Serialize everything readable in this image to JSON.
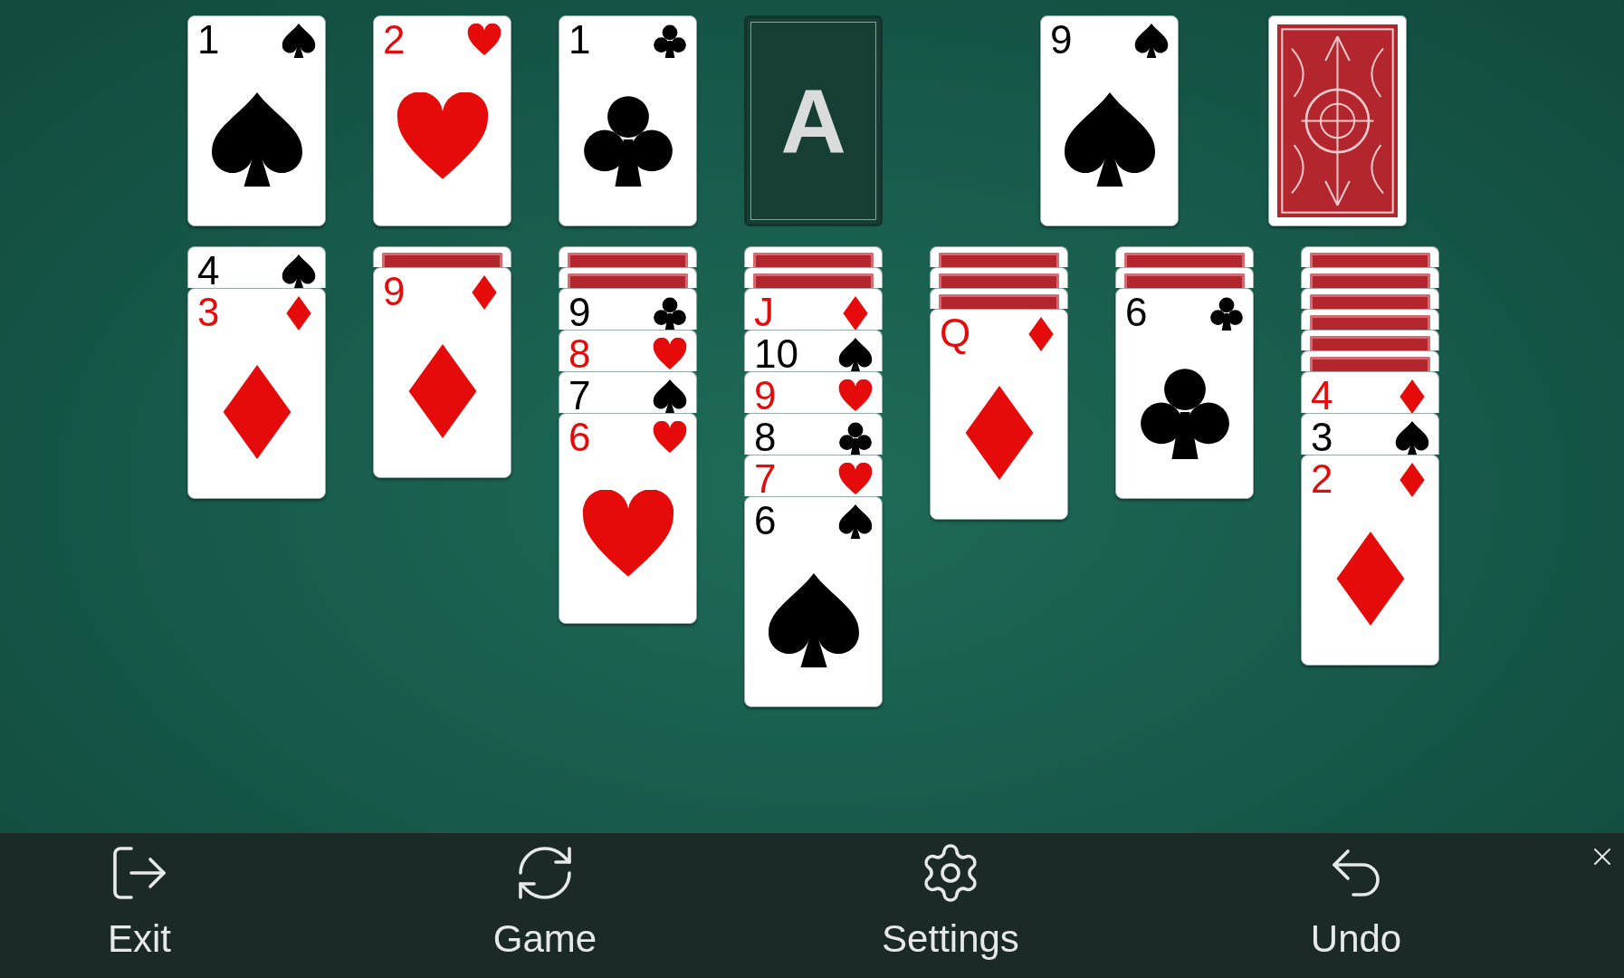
{
  "foundations": [
    {
      "kind": "spades",
      "rank": "1"
    },
    {
      "kind": "hearts",
      "rank": "2"
    },
    {
      "kind": "clubs",
      "rank": "1"
    },
    {
      "kind": "empty",
      "label": "A"
    }
  ],
  "waste": {
    "kind": "spades",
    "rank": "9"
  },
  "stock": {
    "kind": "back"
  },
  "tableau": [
    {
      "face_up": [
        {
          "rank": "4",
          "kind": "spades"
        },
        {
          "rank": "3",
          "kind": "diamonds"
        }
      ]
    },
    {
      "face_down": [
        {
          "kind": "back"
        }
      ],
      "face_up": [
        {
          "rank": "9",
          "kind": "diamonds"
        }
      ]
    },
    {
      "face_down": [
        {
          "kind": "back"
        },
        {
          "kind": "back"
        }
      ],
      "face_up": [
        {
          "rank": "9",
          "kind": "clubs"
        },
        {
          "rank": "8",
          "kind": "hearts"
        },
        {
          "rank": "7",
          "kind": "spades"
        },
        {
          "rank": "6",
          "kind": "hearts"
        }
      ]
    },
    {
      "face_down": [
        {
          "kind": "back"
        },
        {
          "kind": "back"
        }
      ],
      "face_up": [
        {
          "rank": "J",
          "kind": "diamonds"
        },
        {
          "rank": "10",
          "kind": "spades"
        },
        {
          "rank": "9",
          "kind": "hearts"
        },
        {
          "rank": "8",
          "kind": "clubs"
        },
        {
          "rank": "7",
          "kind": "hearts"
        },
        {
          "rank": "6",
          "kind": "spades"
        }
      ]
    },
    {
      "face_down": [
        {
          "kind": "back"
        },
        {
          "kind": "back"
        },
        {
          "kind": "back"
        }
      ],
      "face_up": [
        {
          "rank": "Q",
          "kind": "diamonds"
        }
      ]
    },
    {
      "face_down": [
        {
          "kind": "back"
        },
        {
          "kind": "back"
        }
      ],
      "face_up": [
        {
          "rank": "6",
          "kind": "clubs"
        }
      ]
    },
    {
      "face_down": [
        {
          "kind": "back"
        },
        {
          "kind": "back"
        },
        {
          "kind": "back"
        },
        {
          "kind": "back"
        },
        {
          "kind": "back"
        },
        {
          "kind": "back"
        }
      ],
      "face_up": [
        {
          "rank": "4",
          "kind": "diamonds"
        },
        {
          "rank": "3",
          "kind": "spades"
        },
        {
          "rank": "2",
          "kind": "diamonds"
        }
      ]
    }
  ],
  "toolbar": [
    {
      "kind": "exit",
      "label": "Exit"
    },
    {
      "kind": "game",
      "label": "Game"
    },
    {
      "kind": "settings",
      "label": "Settings"
    },
    {
      "kind": "undo",
      "label": "Undo"
    }
  ]
}
